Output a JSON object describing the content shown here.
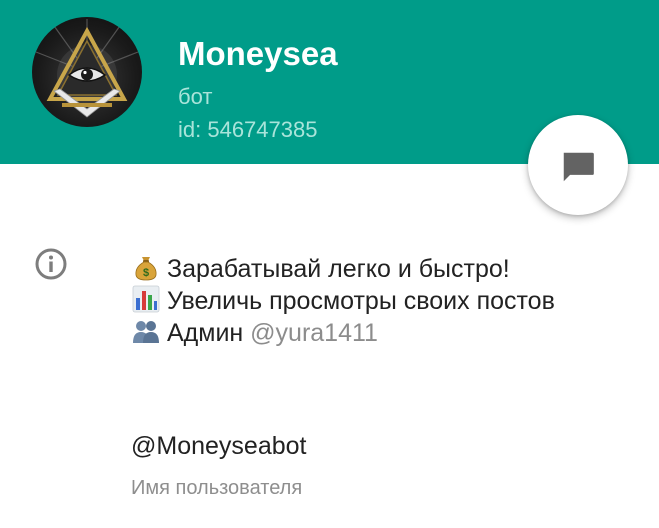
{
  "profile": {
    "name": "Moneysea",
    "type": "бот",
    "id_text": "id: 546747385",
    "header_color": "#009c89"
  },
  "fab": {
    "icon": "chat-bubble-icon"
  },
  "info": {
    "icon": "info-icon",
    "bio_lines": [
      {
        "emoji": "money-bag-icon",
        "text": "Зарабатывай легко и быстро!"
      },
      {
        "emoji": "bar-chart-icon",
        "text": "Увеличь просмотры своих постов"
      },
      {
        "emoji": "busts-icon",
        "text": "Админ ",
        "mention": "@yura1411"
      }
    ],
    "username": "@Moneyseabot",
    "username_label": "Имя пользователя"
  }
}
